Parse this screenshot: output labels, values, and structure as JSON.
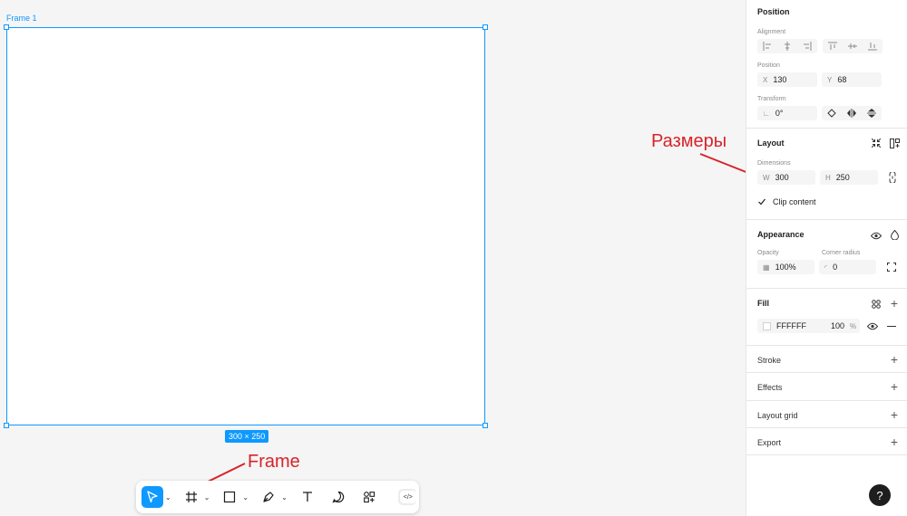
{
  "canvas": {
    "frame_label": "Frame 1",
    "size_badge": "300 × 250"
  },
  "annotations": {
    "frame_label": "Frame",
    "dimensions_label": "Размеры"
  },
  "toolbar": {
    "tools": [
      "move-icon",
      "frame-icon",
      "rectangle-icon",
      "pen-icon",
      "text-icon",
      "comment-icon",
      "actions-icon",
      "dev-mode-icon"
    ],
    "active_tool": "move",
    "dev_toggle_glyph": "</>"
  },
  "panel": {
    "position": {
      "title": "Position",
      "alignment_label": "Alignment",
      "position_label": "Position",
      "x_prefix": "X",
      "x_value": "130",
      "y_prefix": "Y",
      "y_value": "68",
      "transform_label": "Transform",
      "rotation_value": "0°"
    },
    "layout": {
      "title": "Layout",
      "dimensions_label": "Dimensions",
      "w_prefix": "W",
      "w_value": "300",
      "h_prefix": "H",
      "h_value": "250",
      "clip_content_label": "Clip content",
      "clip_content_checked": true
    },
    "appearance": {
      "title": "Appearance",
      "opacity_label": "Opacity",
      "opacity_value": "100%",
      "corner_radius_label": "Corner radius",
      "corner_radius_value": "0"
    },
    "fill": {
      "title": "Fill",
      "color_hex": "FFFFFF",
      "opacity_value": "100",
      "opacity_unit": "%"
    },
    "stroke": {
      "title": "Stroke"
    },
    "effects": {
      "title": "Effects"
    },
    "layout_grid": {
      "title": "Layout grid"
    },
    "export": {
      "title": "Export"
    }
  },
  "help_label": "?",
  "colors": {
    "accent": "#0d99ff",
    "annotation": "#d8232a",
    "canvas_bg": "#f5f5f5"
  }
}
